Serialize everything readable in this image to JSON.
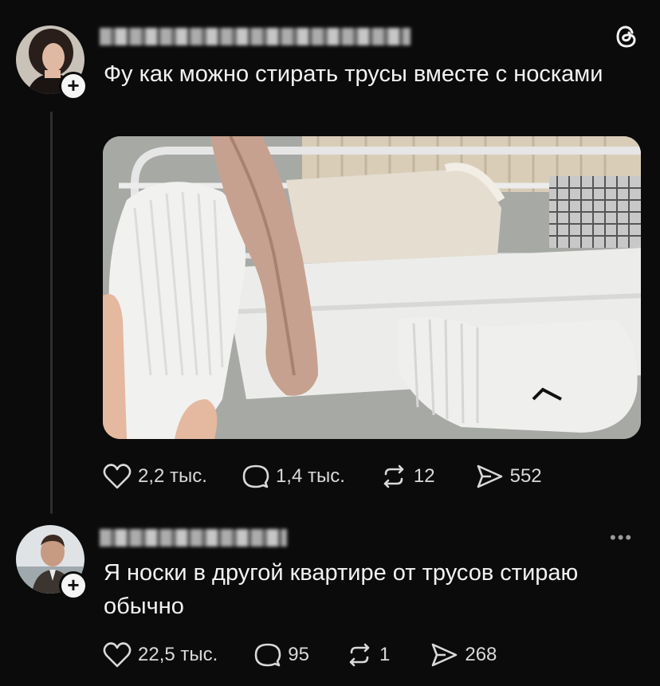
{
  "post": {
    "text": "Фу как можно стирать трусы вместе с носками",
    "image_alt": "Socks and underwear drying on a rack",
    "stats": {
      "likes": "2,2 тыс.",
      "replies": "1,4 тыс.",
      "reposts": "12",
      "shares": "552"
    }
  },
  "reply": {
    "text": "Я носки в другой квартире от трусов стираю обычно",
    "stats": {
      "likes": "22,5 тыс.",
      "replies": "95",
      "reposts": "1",
      "shares": "268"
    }
  },
  "icons": {
    "logo": "threads-logo-icon",
    "like": "heart-icon",
    "reply": "comment-icon",
    "repost": "repost-icon",
    "share": "send-icon",
    "more": "more-icon",
    "follow": "plus-icon"
  }
}
